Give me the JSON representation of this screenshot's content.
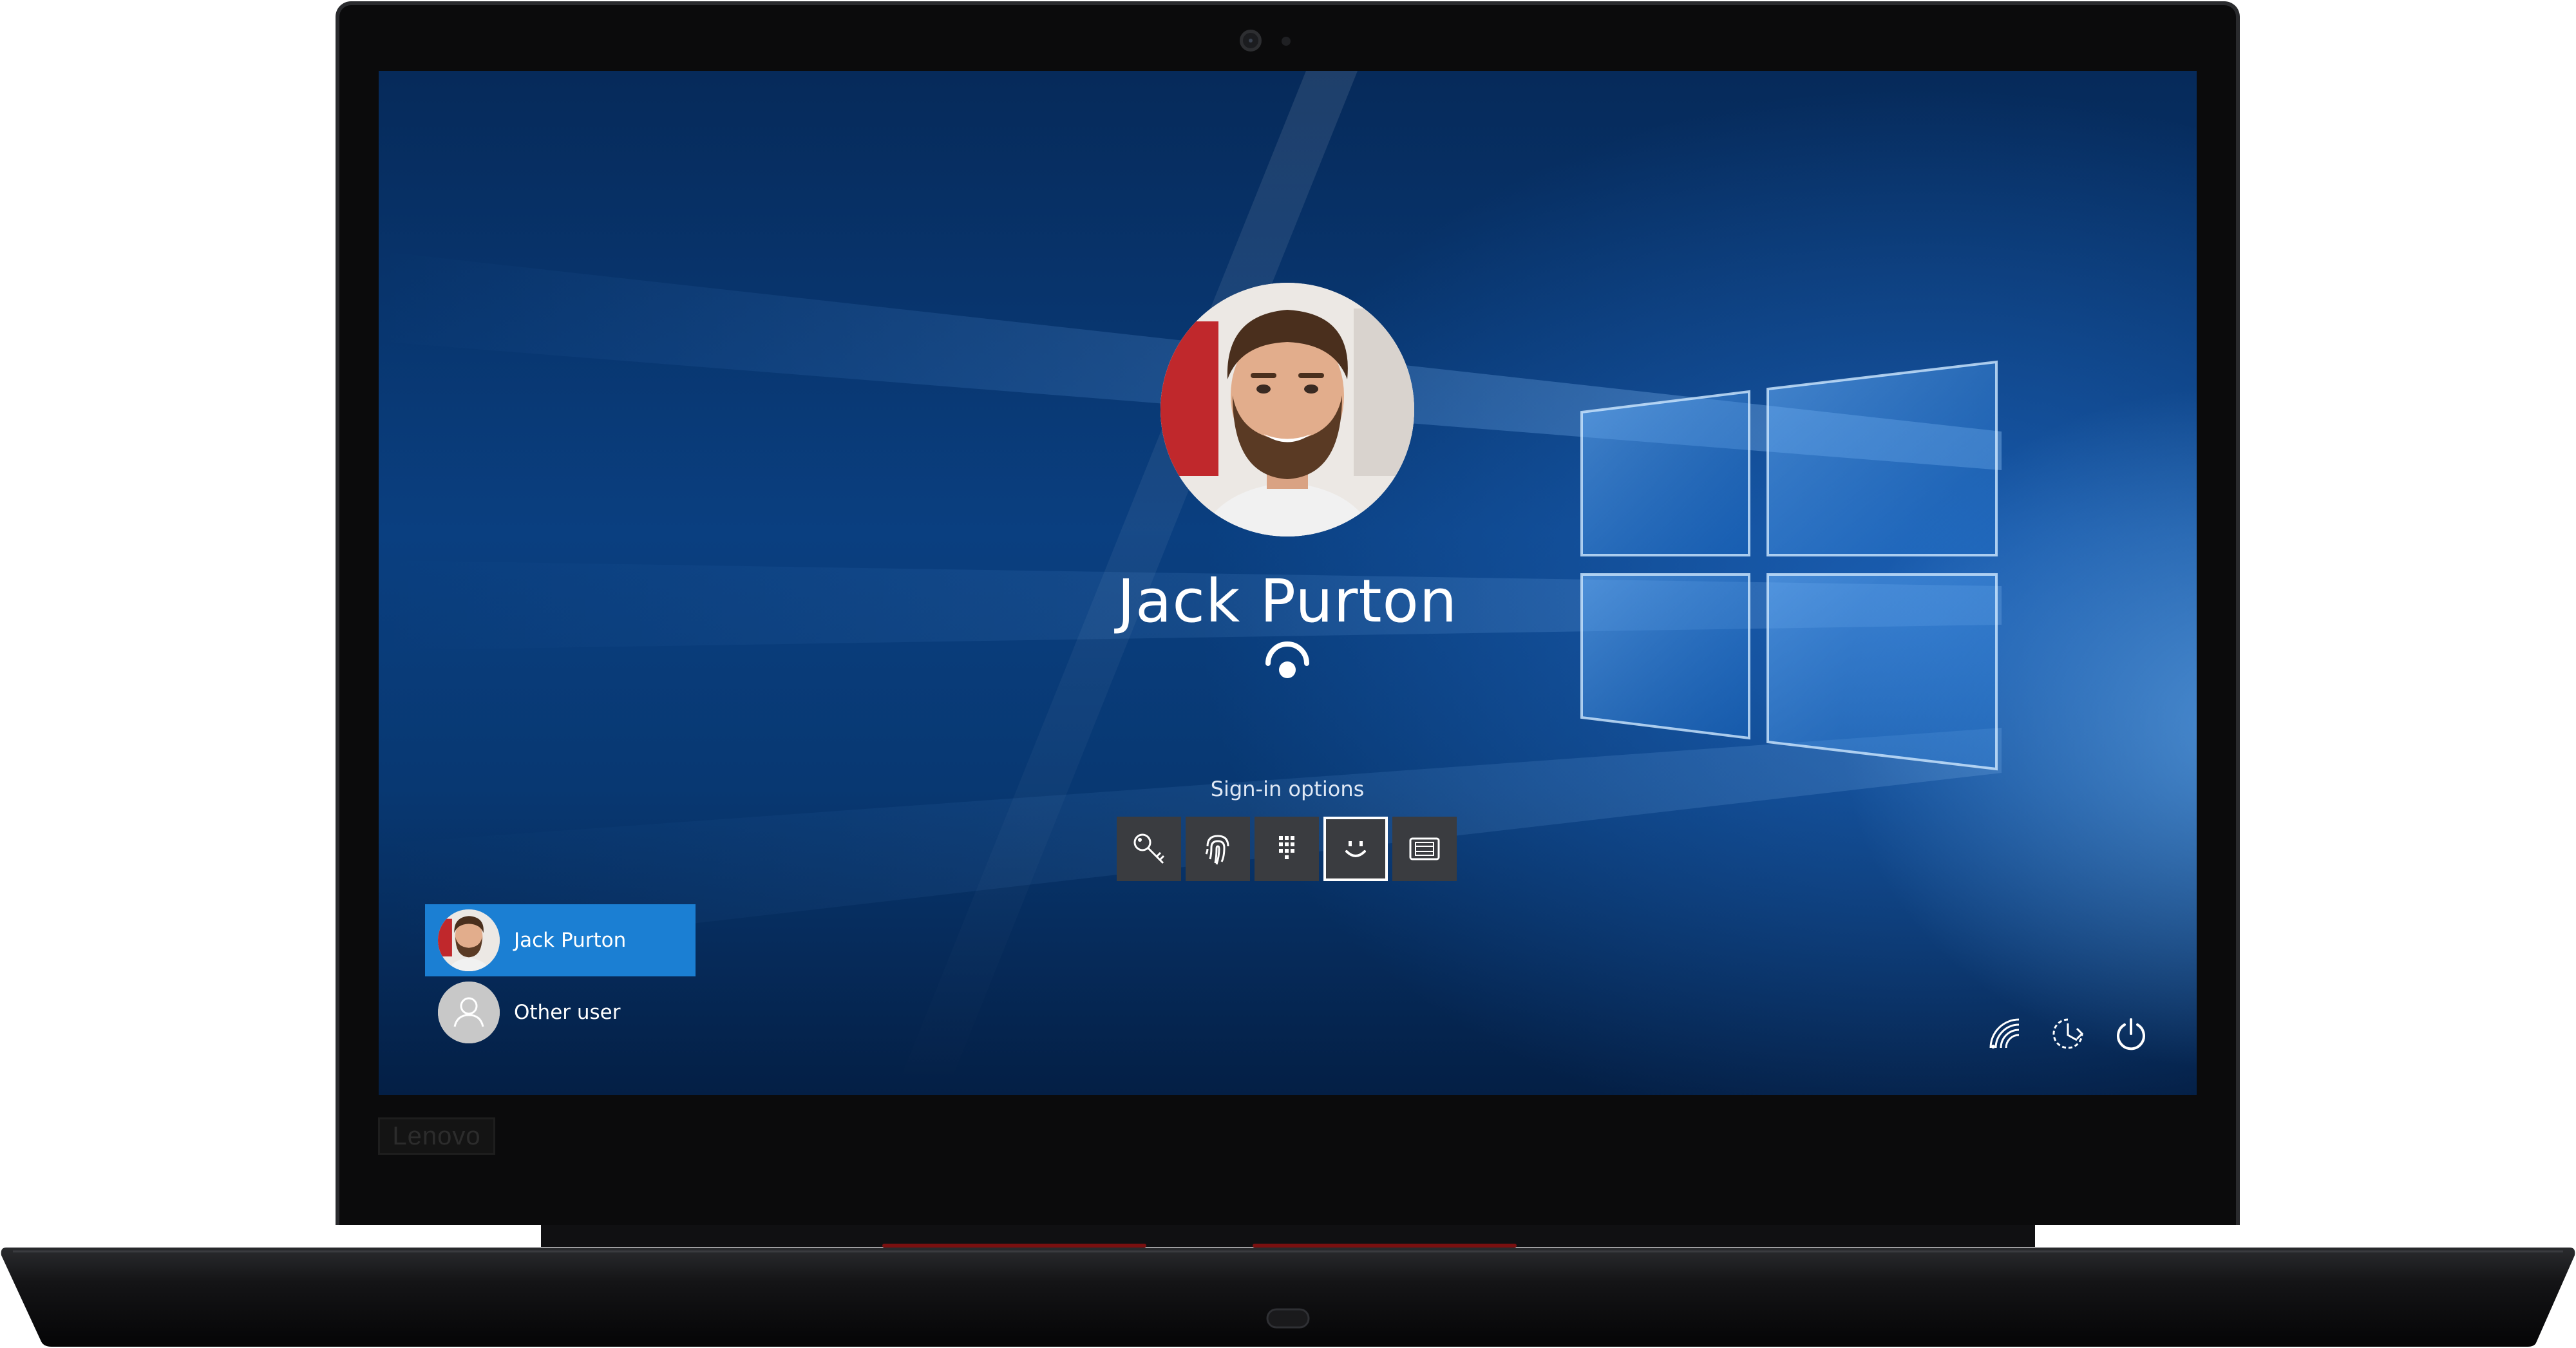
{
  "device": {
    "brand_label": "Lenovo"
  },
  "lock_screen": {
    "user_name": "Jack Purton",
    "signin_options_label": "Sign-in options",
    "signin_options": [
      {
        "icon": "key-icon",
        "selected": false
      },
      {
        "icon": "fingerprint-icon",
        "selected": false
      },
      {
        "icon": "pin-keypad-icon",
        "selected": false
      },
      {
        "icon": "face-recognition-icon",
        "selected": true
      },
      {
        "icon": "smart-card-icon",
        "selected": false
      }
    ],
    "face_status_icon": "face-scan-icon"
  },
  "user_list": [
    {
      "label": "Jack Purton",
      "active": true,
      "avatar": "photo"
    },
    {
      "label": "Other user",
      "active": false,
      "avatar": "generic-person"
    }
  ],
  "tray": [
    {
      "icon": "network-icon"
    },
    {
      "icon": "ease-of-access-icon"
    },
    {
      "icon": "power-icon"
    }
  ],
  "colors": {
    "accent": "#1b7fd3",
    "wallpaper_dark": "#062a5a",
    "wallpaper_light": "#2f8be0",
    "option_tile": "#3a3c40"
  }
}
